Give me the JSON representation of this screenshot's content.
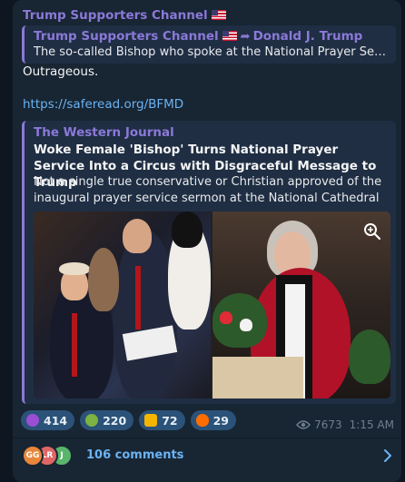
{
  "channel": {
    "name": "Trump Supporters Channel"
  },
  "forward": {
    "channel_name": "Trump Supporters Channel",
    "author": "Donald J. Trump",
    "text": "The so-called Bishop who spoke at the National Prayer Service o..."
  },
  "message": {
    "text": "Outrageous.",
    "link": "https://saferead.org/BFMD"
  },
  "preview": {
    "site_name": "The Western Journal",
    "headline": "Woke Female 'Bishop' Turns National Prayer Service Into a Circus with Disgraceful Message to Trump",
    "description": "Not a single true conservative or Christian approved of the inaugural prayer service sermon at the National Cathedral on Tu..."
  },
  "reactions": [
    {
      "emoji": "smiling-devil-icon",
      "count": "414",
      "color": "#9b4dd6"
    },
    {
      "emoji": "nauseated-face-icon",
      "count": "220",
      "color": "#7cb342"
    },
    {
      "emoji": "middle-finger-icon",
      "count": "72",
      "color": "#f4b400"
    },
    {
      "emoji": "fire-icon",
      "count": "29",
      "color": "#ff6d00"
    }
  ],
  "meta": {
    "views": "7673",
    "time": "1:15 AM"
  },
  "comments": {
    "label": "106 comments",
    "avatars": [
      {
        "initials": "GG",
        "color": "#e8863a"
      },
      {
        "initials": "LR",
        "color": "#e06666"
      },
      {
        "initials": "J",
        "color": "#59b56b"
      }
    ]
  },
  "colors": {
    "accent": "#8b79d9",
    "link": "#6ab3f3",
    "bubble": "#182533",
    "background": "#0e1621"
  }
}
